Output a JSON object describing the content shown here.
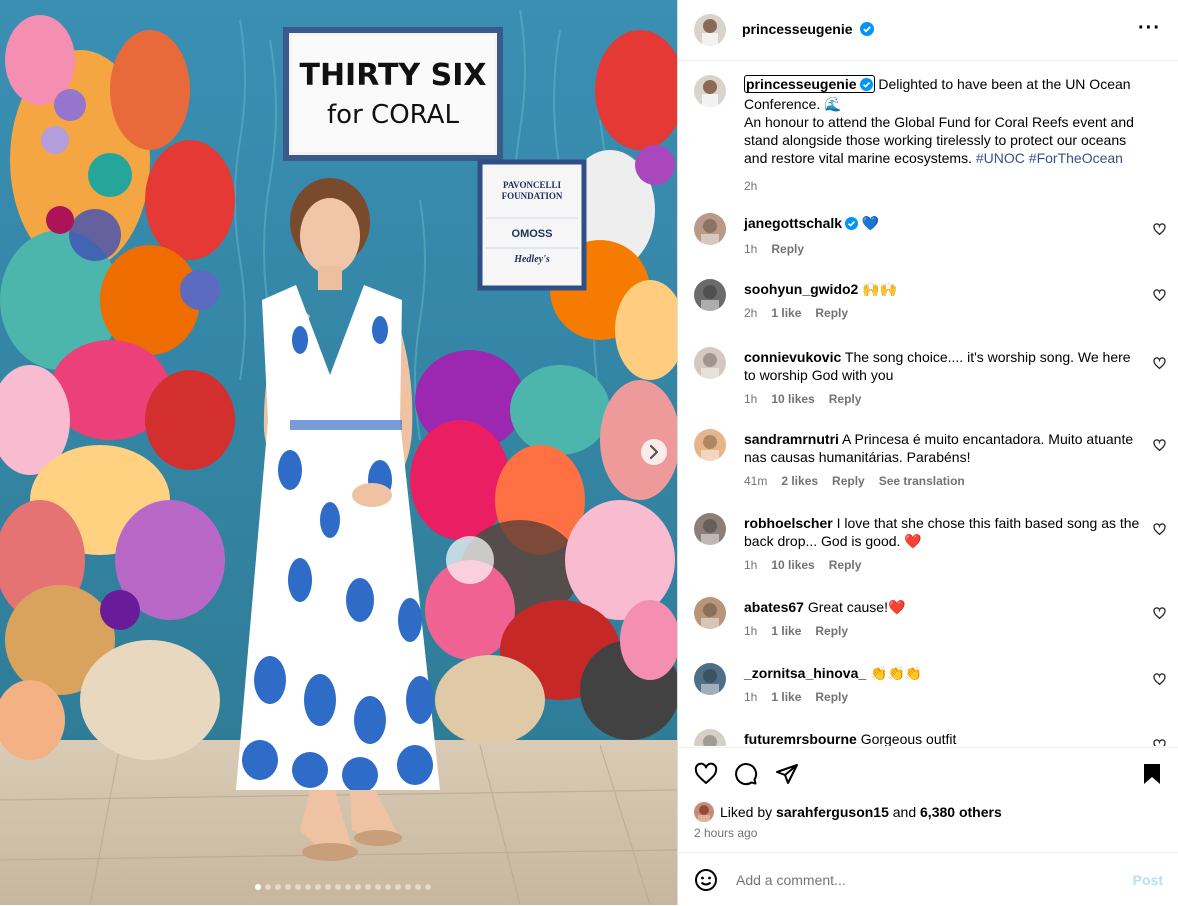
{
  "post": {
    "username": "princesseugenie",
    "caption_intro": "Delighted to have been at the UN Ocean Conference.",
    "caption_emoji": "🌊",
    "caption_body": "An honour to attend the Global Fund for Coral Reefs event and stand alongside those working tirelessly to protect our oceans and restore vital marine ecosystems.",
    "hashtags": [
      "#UNOC",
      "#ForTheOcean"
    ],
    "time": "2h"
  },
  "photo": {
    "sign_line1": "THIRTY SIX",
    "sign_line2": "for CORAL",
    "sponsor1": "PAVONCELLI FOUNDATION",
    "sponsor2": "OMOSS",
    "sponsor3": "Hedley's",
    "carousel_dots": 18,
    "active_dot": 0
  },
  "comments": [
    {
      "user": "janegottschalk",
      "text": "💙",
      "verified": true,
      "time": "1h",
      "likes": "",
      "reply": "Reply",
      "translate": ""
    },
    {
      "user": "soohyun_gwido2",
      "text": "🙌🙌",
      "verified": false,
      "time": "2h",
      "likes": "1 like",
      "reply": "Reply",
      "translate": ""
    },
    {
      "user": "connievukovic",
      "text": "The song choice.... it's worship song. We here to worship God with you",
      "verified": false,
      "time": "1h",
      "likes": "10 likes",
      "reply": "Reply",
      "translate": ""
    },
    {
      "user": "sandramrnutri",
      "text": "A Princesa é muito encantadora. Muito atuante nas causas humanitárias. Parabéns!",
      "verified": false,
      "time": "41m",
      "likes": "2 likes",
      "reply": "Reply",
      "translate": "See translation"
    },
    {
      "user": "robhoelscher",
      "text": "I love that she chose this faith based song as the back drop... God is good. ❤️",
      "verified": false,
      "time": "1h",
      "likes": "10 likes",
      "reply": "Reply",
      "translate": ""
    },
    {
      "user": "abates67",
      "text": "Great cause!❤️",
      "verified": false,
      "time": "1h",
      "likes": "1 like",
      "reply": "Reply",
      "translate": ""
    },
    {
      "user": "_zornitsa_hinova_",
      "text": "👏👏👏",
      "verified": false,
      "time": "1h",
      "likes": "1 like",
      "reply": "Reply",
      "translate": ""
    },
    {
      "user": "futuremrsbourne",
      "text": "Gorgeous outfit",
      "verified": false,
      "time": "",
      "likes": "",
      "reply": "",
      "translate": ""
    }
  ],
  "likes": {
    "prefix": "Liked by",
    "user": "sarahferguson15",
    "and": "and",
    "others": "6,380 others",
    "posted": "2 hours ago"
  },
  "add_comment": {
    "placeholder": "Add a comment...",
    "post_label": "Post"
  },
  "colors": {
    "verified": "#0095f6",
    "hashtag": "#385185",
    "muted": "#737373"
  }
}
